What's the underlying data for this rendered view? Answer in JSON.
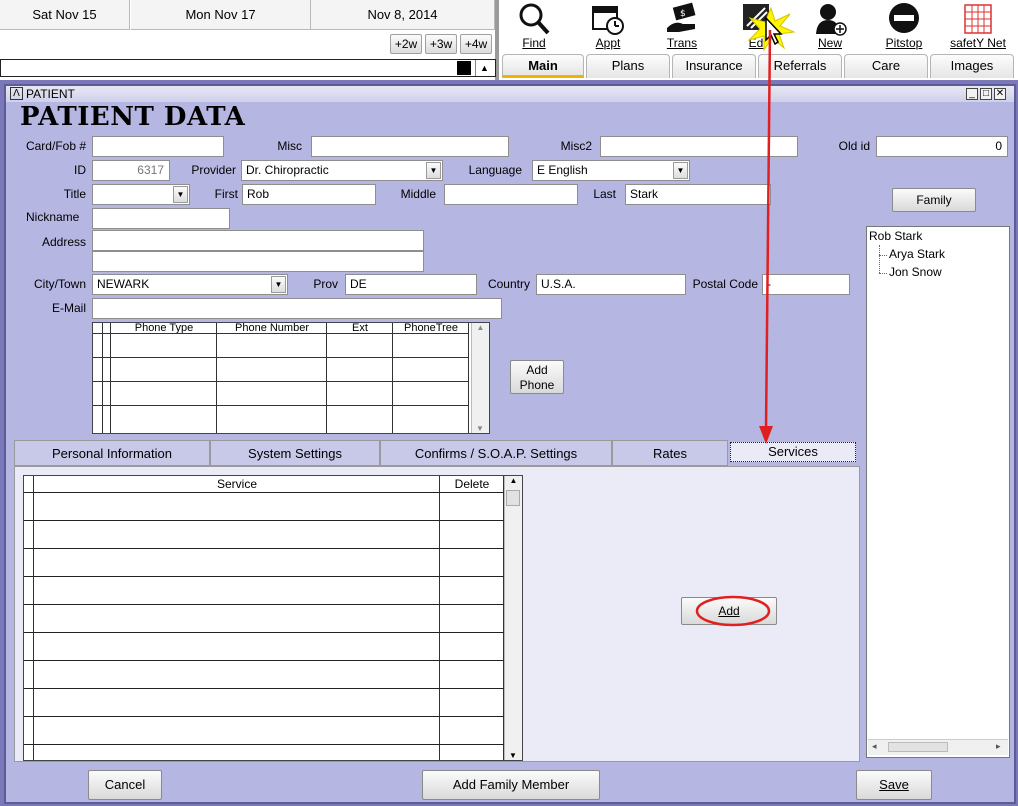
{
  "dates": [
    "Sat Nov 15",
    "Mon Nov 17",
    "Nov  8, 2014"
  ],
  "week_buttons": [
    "+2w",
    "+3w",
    "+4w"
  ],
  "toolbar": [
    {
      "label": "Find",
      "icon": "magnifier-icon"
    },
    {
      "label": "Appt",
      "icon": "calendar-clock-icon"
    },
    {
      "label": "Trans",
      "icon": "money-hand-icon"
    },
    {
      "label": "Ed",
      "icon": "edit-icon"
    },
    {
      "label": "New",
      "icon": "new-patient-icon"
    },
    {
      "label": "Pitstop",
      "icon": "stop-sign-icon"
    },
    {
      "label": "safetY Net",
      "icon": "safety-net-icon"
    }
  ],
  "main_tabs": [
    "Main",
    "Plans",
    "Insurance",
    "Referrals",
    "Care",
    "Images"
  ],
  "window": {
    "title": "PATIENT",
    "header": "PATIENT DATA"
  },
  "labels": {
    "card": "Card/Fob #",
    "misc": "Misc",
    "misc2": "Misc2",
    "old_id": "Old id",
    "id": "ID",
    "provider": "Provider",
    "language": "Language",
    "title": "Title",
    "first": "First",
    "middle": "Middle",
    "last": "Last",
    "nickname": "Nickname",
    "address": "Address",
    "city": "City/Town",
    "prov": "Prov",
    "country": "Country",
    "postal": "Postal Code",
    "email": "E-Mail"
  },
  "values": {
    "card": "",
    "misc": "",
    "misc2": "",
    "old_id": "0",
    "id": "6317",
    "provider": "Dr. Chiropractic",
    "language": "E English",
    "title": "",
    "first": "Rob",
    "middle": "",
    "last": "Stark",
    "nickname": "",
    "address1": "",
    "address2": "",
    "city": "NEWARK",
    "prov": "DE",
    "country": "U.S.A.",
    "postal": " -",
    "email": ""
  },
  "phone_grid": {
    "columns": [
      "Phone Type",
      "Phone Number",
      "Ext",
      "PhoneTree"
    ]
  },
  "add_phone": "Add Phone",
  "family_button": "Family",
  "family_tree": {
    "root": "Rob Stark",
    "children": [
      "Arya Stark",
      "Jon Snow"
    ]
  },
  "sub_tabs": [
    "Personal Information",
    "System Settings",
    "Confirms / S.O.A.P. Settings",
    "Rates",
    "Services"
  ],
  "services_grid": {
    "columns": [
      "Service",
      "Delete"
    ]
  },
  "add_button": "Add",
  "footer": {
    "cancel": "Cancel",
    "add_family": "Add Family Member",
    "save": "Save"
  },
  "colors": {
    "window_bg": "#b6b6e2",
    "accent_underline": "#f0b400",
    "annotation_red": "#e02020"
  }
}
